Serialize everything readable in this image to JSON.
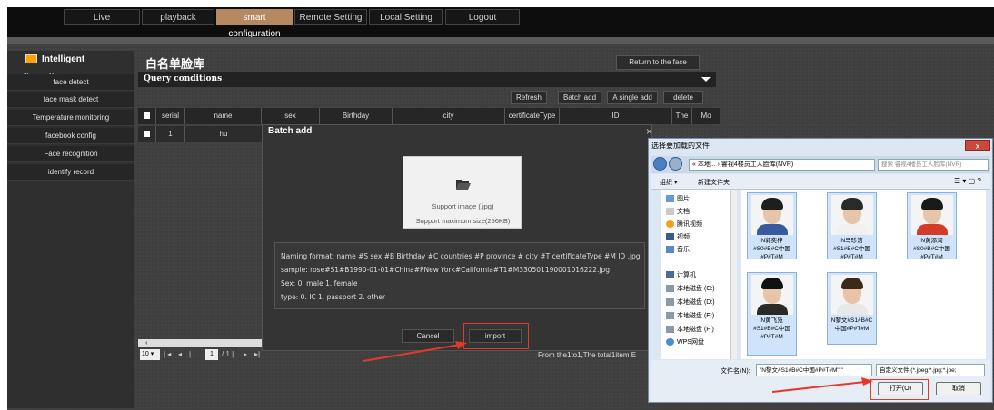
{
  "nav": {
    "tabs": [
      {
        "label": "Live",
        "active": false
      },
      {
        "label": "playback",
        "active": false
      },
      {
        "label": "smart configuration",
        "active": true
      },
      {
        "label": "Remote Setting",
        "active": false
      },
      {
        "label": "Local Setting",
        "active": false
      },
      {
        "label": "Logout",
        "active": false
      }
    ]
  },
  "sidebar": {
    "title": "Intelligent configuration",
    "items": [
      "face detect",
      "face mask detect",
      "Temperature monitoring",
      "facebook config",
      "Face recognition",
      "identify record"
    ]
  },
  "page": {
    "title": "白名单脸库",
    "return_label": "Return to the face"
  },
  "query": {
    "label": "Query conditions"
  },
  "toolbar": {
    "refresh": "Refresh",
    "batch_add": "Batch add",
    "single_add": "A single add",
    "delete": "delete"
  },
  "table": {
    "headers": [
      "serial",
      "name",
      "sex",
      "Birthday",
      "city",
      "certificateType",
      "ID",
      "The",
      "Mo"
    ],
    "rows": [
      {
        "serial": "1",
        "name": "hu"
      }
    ]
  },
  "pager": {
    "page_size": "10",
    "page_input": "1",
    "total_pages": "/ 1 |",
    "record_info": "From the1to1,The total1item E"
  },
  "batch_dialog": {
    "title": "Batch add",
    "close": "×",
    "upload_line1": "Support image (.jpg)",
    "upload_line2": "Support maximum size(256KB)",
    "format_lines": [
      "Naming format:  name #S sex #B Birthday #C countries #P province # city #T certificateType #M ID .jpg",
      "sample:  rose#S1#B1990-01-01#China#PNew York#California#T1#M330501190001016222.jpg",
      "Sex:  0. male 1. female",
      "type:  0. IC 1. passport 2. other"
    ],
    "cancel": "Cancel",
    "import": "import"
  },
  "file_dialog": {
    "title": "选择要加载的文件",
    "close": "x",
    "address": "« 本地... › 睿视4楼员工人脸库(NVR)",
    "search_placeholder": "搜索 睿视4楼员工人脸库(NVR)",
    "organize": "组织 ▾",
    "new_folder": "新建文件夹",
    "nav_items": [
      "图片",
      "文档",
      "腾讯视频",
      "视频",
      "音乐",
      "计算机",
      "本地磁盘 (C:)",
      "本地磁盘 (D:)",
      "本地磁盘 (E:)",
      "本地磁盘 (F:)",
      "WPS网盘"
    ],
    "files": [
      {
        "name": "N郭奕梓 #S0#B#C中国 #P#T#M",
        "shirt": "#3a5aa0",
        "hair": "#1e1e1e"
      },
      {
        "name": "N马珍洁 #S1#B#C中国 #P#T#M",
        "shirt": "#f0f0f0",
        "hair": "#2a2a2a"
      },
      {
        "name": "N黄添润 #S0#B#C中国 #P#T#M",
        "shirt": "#d23a2a",
        "hair": "#1a1a1a"
      },
      {
        "name": "N黄飞凫 #S1#B#C中国 #P#T#M",
        "shirt": "#2a2a2a",
        "hair": "#111111"
      },
      {
        "name": "N黎文#S1#B#C 中国#P#T#M",
        "shirt": "#e8e8e8",
        "hair": "#3a2a1a"
      }
    ],
    "filename_label": "文件名(N):",
    "filename_value": "\"N黎文#S1#B#C中国#P#T#M\" \"",
    "filetype_value": "自定义文件 (*.jpeg;*.jpg;*.jpe;",
    "open": "打开(O)",
    "cancel": "取消"
  }
}
